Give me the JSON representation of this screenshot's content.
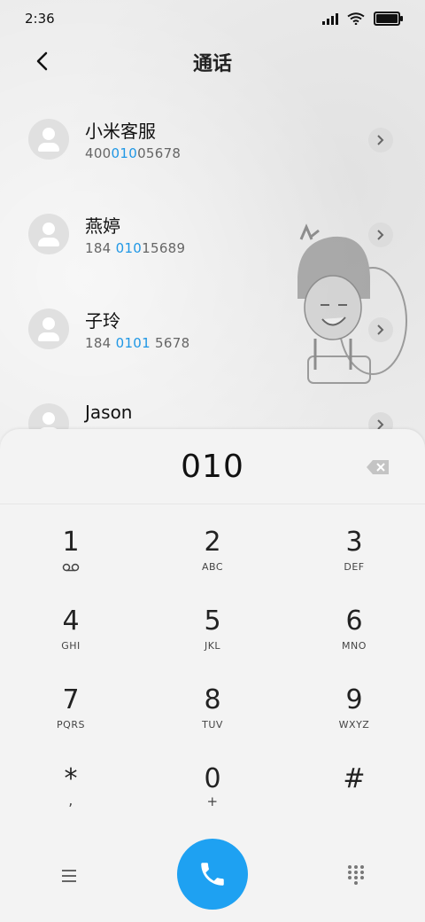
{
  "status_bar": {
    "time": "2:36"
  },
  "header": {
    "title": "通话"
  },
  "contacts": [
    {
      "name": "小米客服",
      "number_parts": [
        "400",
        "010",
        "05678"
      ]
    },
    {
      "name": "燕婷",
      "number_parts": [
        "184 ",
        "010",
        "15689"
      ]
    },
    {
      "name": "子玲",
      "number_parts": [
        "184 ",
        "0101",
        " 5678"
      ]
    },
    {
      "name": "Jason",
      "number_parts": [
        "",
        "",
        ""
      ]
    }
  ],
  "dialer": {
    "input": "010",
    "keys": [
      {
        "num": "1",
        "sub": "voicemail-icon"
      },
      {
        "num": "2",
        "sub": "ABC"
      },
      {
        "num": "3",
        "sub": "DEF"
      },
      {
        "num": "4",
        "sub": "GHI"
      },
      {
        "num": "5",
        "sub": "JKL"
      },
      {
        "num": "6",
        "sub": "MNO"
      },
      {
        "num": "7",
        "sub": "PQRS"
      },
      {
        "num": "8",
        "sub": "TUV"
      },
      {
        "num": "9",
        "sub": "WXYZ"
      },
      {
        "num": "*",
        "sub": ","
      },
      {
        "num": "0",
        "sub": "+"
      },
      {
        "num": "#",
        "sub": ""
      }
    ]
  },
  "colors": {
    "accent": "#1ea1f2",
    "highlight": "#1f97e5"
  },
  "icons": [
    "back-arrow-icon",
    "chevron-right-icon",
    "backspace-icon",
    "menu-icon",
    "phone-icon",
    "dialpad-grid-icon",
    "voicemail-icon"
  ]
}
